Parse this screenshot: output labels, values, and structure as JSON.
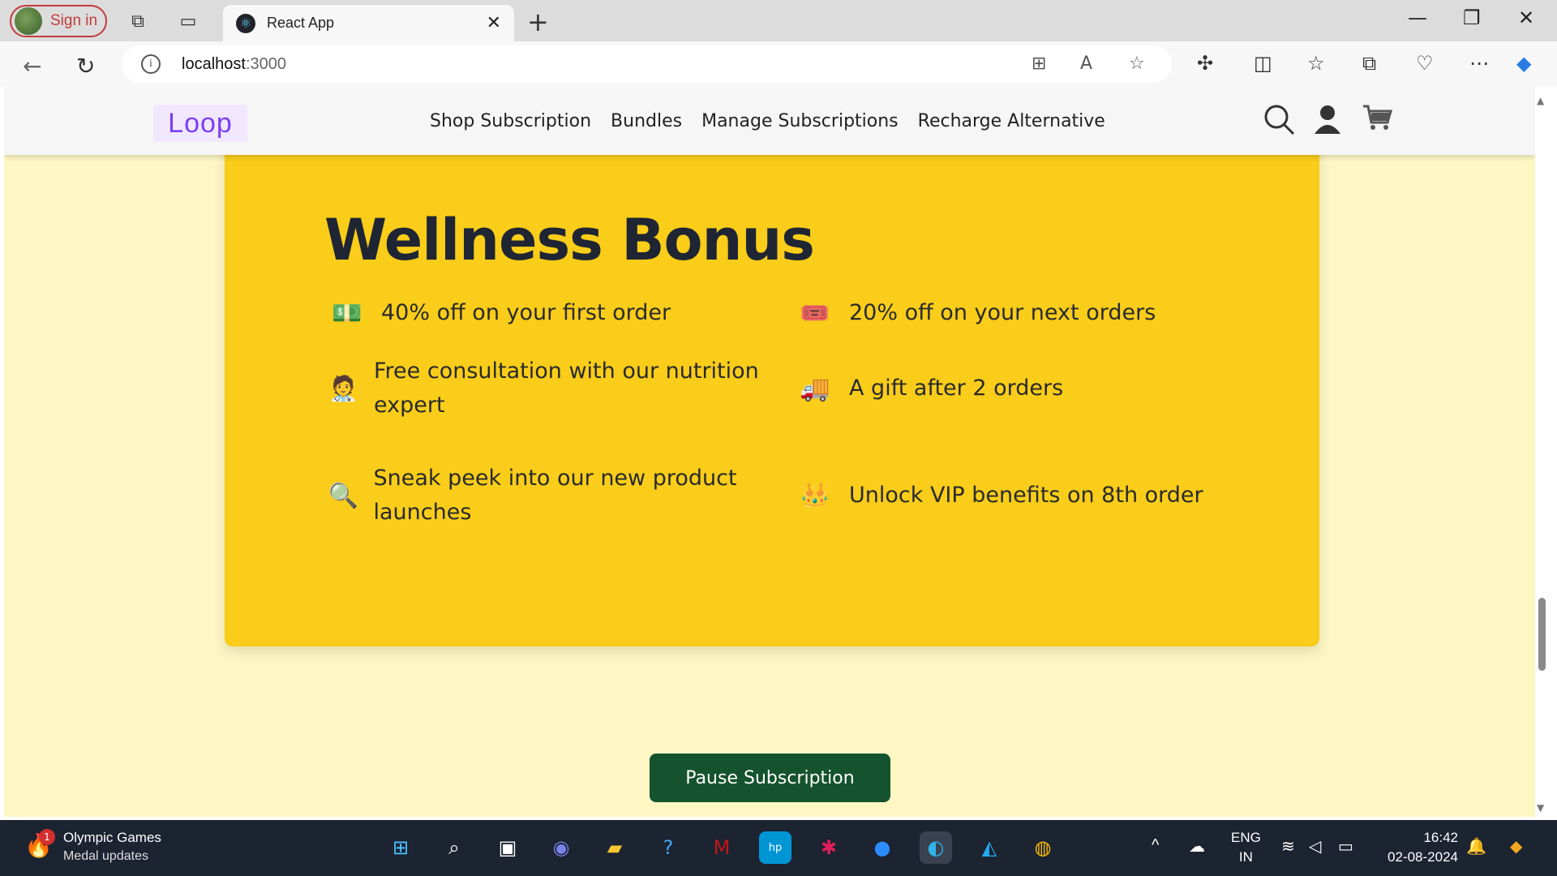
{
  "browser": {
    "signin_label": "Sign in",
    "tab_title": "React App",
    "url_host": "localhost",
    "url_port": ":3000"
  },
  "site": {
    "logo": "Loop",
    "nav": [
      "Shop Subscription",
      "Bundles",
      "Manage Subscriptions",
      "Recharge Alternative"
    ]
  },
  "bonus": {
    "title": "Wellness Bonus",
    "items": [
      {
        "icon": "💵",
        "text": "40% off on your first order"
      },
      {
        "icon": "🎟️",
        "text": "20% off on your next orders"
      },
      {
        "icon": "🧑‍⚕️",
        "text": "Free consultation with our nutrition expert"
      },
      {
        "icon": "🚚",
        "text": "A gift after 2 orders"
      },
      {
        "icon": "🔍",
        "text": "Sneak peek into our new product launches"
      },
      {
        "icon": "👑",
        "text": "Unlock VIP benefits on 8th order"
      }
    ]
  },
  "pause_button": "Pause Subscription",
  "taskbar": {
    "widget_title": "Olympic Games",
    "widget_subtitle": "Medal updates",
    "widget_badge": "1",
    "lang_1": "ENG",
    "lang_2": "IN",
    "time": "16:42",
    "date": "02-08-2024"
  }
}
